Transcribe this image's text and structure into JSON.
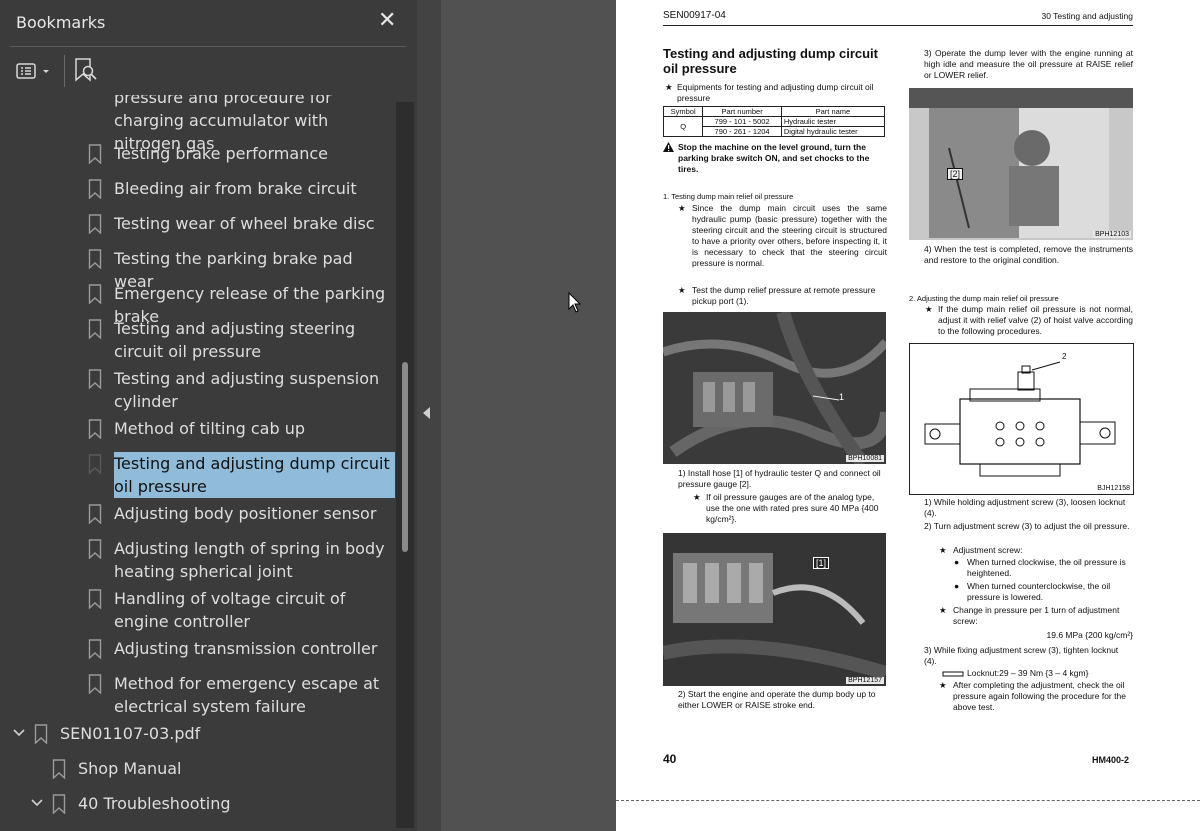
{
  "panel": {
    "title": "Bookmarks",
    "close_glyph": "✕",
    "options_icon": "options-menu-icon",
    "find_bookmark_icon": "bookmark-search-icon"
  },
  "bookmarks": [
    {
      "label": "pressure and procedure for charging accumulator with nitrogen gas"
    },
    {
      "label": "Testing brake performance"
    },
    {
      "label": "Bleeding air from brake circuit"
    },
    {
      "label": "Testing wear of wheel brake disc"
    },
    {
      "label": "Testing the parking brake pad wear"
    },
    {
      "label": "Emergency release of the parking brake"
    },
    {
      "label": "Testing and adjusting steering circuit oil pressure"
    },
    {
      "label": "Testing and adjusting suspension cylinder"
    },
    {
      "label": "Method of tilting cab up"
    },
    {
      "label": "Testing and adjusting dump circuit oil pressure",
      "selected": true
    },
    {
      "label": "Adjusting body positioner sensor"
    },
    {
      "label": "Adjusting length of spring in body heating spherical joint"
    },
    {
      "label": "Handling of voltage circuit of engine controller"
    },
    {
      "label": "Adjusting transmission controller"
    },
    {
      "label": "Method for emergency escape at electrical system failure"
    },
    {
      "label": "SEN01107-03.pdf"
    },
    {
      "label": "Shop Manual"
    },
    {
      "label": "40 Troubleshooting"
    }
  ],
  "doc": {
    "header_left": "SEN00917-04",
    "header_right": "30 Testing and adjusting",
    "title": "Testing and adjusting dump circuit oil pressure",
    "equip_intro": "Equipments for testing and adjusting dump circuit oil pressure",
    "table": {
      "headers": [
        "Symbol",
        "Part number",
        "Part name"
      ],
      "symbol": "Q",
      "rows": [
        [
          "799 - 101 - 5002",
          "Hydraulic tester"
        ],
        [
          "790 - 261 - 1204",
          "Digital hydraulic tester"
        ]
      ]
    },
    "warning": "Stop the machine on the level ground, turn the parking brake switch ON, and set chocks to the tires.",
    "sec1_title": "1.  Testing dump main relief oil pressure",
    "sec1_b1": "Since the dump main circuit uses the same hydraulic pump (basic pressure) together with the steering circuit and the steering circuit is structured to have a priority over others, before inspecting it, it is necessary to check that the steering circuit pressure is normal.",
    "sec1_b2": "Test the dump relief pressure at remote pressure pickup port (1).",
    "photo1_tag": "BPH10081",
    "photo1_callout": "1",
    "step1": "1)  Install hose [1] of hydraulic tester Q and connect oil pressure gauge [2].",
    "step1_note": "If oil pressure gauges are of the analog type, use the one with rated pres sure 40 MPa {400 kg/cm²}.",
    "photo2_tag": "BPH12157",
    "photo2_callout": "[1]",
    "step2": "2)  Start the engine and operate the dump body up to either LOWER or RAISE stroke end.",
    "step3": "3)  Operate the dump lever with the engine running at high idle and measure the oil pressure at RAISE relief or LOWER relief.",
    "photo3_tag": "BPH12103",
    "photo3_callout": "[2]",
    "step4": "4)  When the test is completed, remove the instruments and restore to the original condition.",
    "sec2_title": "2.  Adjusting the dump main relief oil pressure",
    "sec2_note": "If the dump main relief oil pressure is not normal, adjust it with relief valve (2) of hoist valve according to the following procedures.",
    "diagram_tag": "BJH12158",
    "diagram_callout": "2",
    "adj1": "1)  While holding adjustment screw (3), loosen locknut (4).",
    "adj2": "2)  Turn adjustment screw (3) to adjust the oil pressure.",
    "adj2_sub": "Adjustment screw:",
    "adj2_cw": "When turned clockwise, the oil pressure is heightened.",
    "adj2_ccw": "When turned counterclockwise, the oil pressure is lowered.",
    "adj2_change": "Change in pressure per 1 turn of adjustment screw:",
    "adj2_value": "19.6 MPa {200 kg/cm²}",
    "adj3": "3)  While fixing adjustment screw (3), tighten locknut (4).",
    "adj3_torque": "Locknut:29 – 39 Nm {3 – 4 kgm}",
    "adj3_note": "After completing the adjustment, check the oil pressure again following the procedure for the above test.",
    "page_number": "40",
    "model": "HM400-2"
  },
  "colors": {
    "panel_bg": "#3b3b3b",
    "selected_bg": "#90bbd9",
    "viewer_bg": "#515151"
  }
}
